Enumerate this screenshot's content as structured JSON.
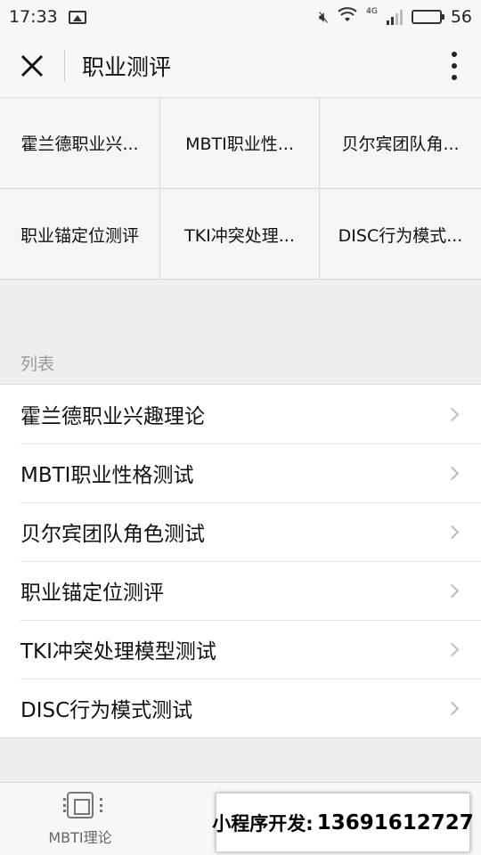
{
  "status_bar": {
    "time": "17:33",
    "battery": "56",
    "network": "4G"
  },
  "nav": {
    "title": "职业测评"
  },
  "grid": {
    "items": [
      {
        "label": "霍兰德职业兴..."
      },
      {
        "label": "MBTI职业性..."
      },
      {
        "label": "贝尔宾团队角..."
      },
      {
        "label": "职业锚定位测评"
      },
      {
        "label": "TKI冲突处理..."
      },
      {
        "label": "DISC行为模式..."
      }
    ]
  },
  "list": {
    "header": "列表",
    "items": [
      {
        "label": "霍兰德职业兴趣理论"
      },
      {
        "label": "MBTI职业性格测试"
      },
      {
        "label": "贝尔宾团队角色测试"
      },
      {
        "label": "职业锚定位测评"
      },
      {
        "label": "TKI冲突处理模型测试"
      },
      {
        "label": "DISC行为模式测试"
      }
    ]
  },
  "tab_bar": {
    "items": [
      {
        "label": "MBTI理论",
        "icon": "chip-icon"
      }
    ]
  },
  "watermark": {
    "prefix": "小程序开发:",
    "phone": "13691612727"
  }
}
